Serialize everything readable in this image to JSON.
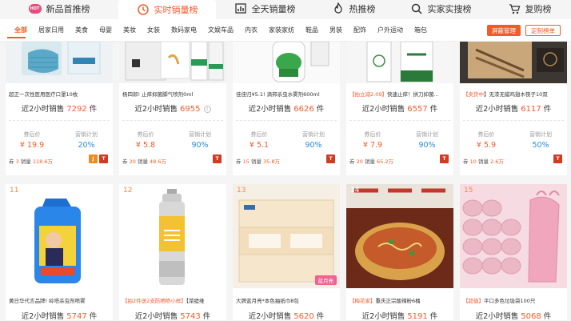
{
  "top_tabs": [
    {
      "label": "新品首推榜",
      "icon": "hot-badge",
      "icon_text": "HOT",
      "active": false
    },
    {
      "label": "实时销量榜",
      "icon": "clock-icon",
      "active": true
    },
    {
      "label": "全天销量榜",
      "icon": "bar-chart-icon",
      "active": false
    },
    {
      "label": "热推榜",
      "icon": "flame-icon",
      "active": false
    },
    {
      "label": "实家实搜榜",
      "icon": "search-icon",
      "active": false
    },
    {
      "label": "复购榜",
      "icon": "cart-icon",
      "active": false
    }
  ],
  "categories": [
    "全部",
    "居家日用",
    "美食",
    "母婴",
    "美妆",
    "女装",
    "数码家电",
    "文娱车品",
    "内衣",
    "家装家纺",
    "鞋品",
    "男装",
    "配饰",
    "户外运动",
    "箱包"
  ],
  "category_buttons": {
    "manage": "屏蔽管理",
    "custom": "定制榜单"
  },
  "labels": {
    "coupon_price": "券后价",
    "commission": "营销计划",
    "sales_prefix": "近2小时销售",
    "sales_suffix": "件",
    "coupon_prefix": "券",
    "sold_prefix": "销量"
  },
  "products_row1": [
    {
      "title": "超正一次性医用医疗口罩10枚",
      "sales": "7292",
      "price": "¥ 19.9",
      "commission": "20%",
      "coupon": "3",
      "sold": "118.6万",
      "badges": [
        "jd",
        "tm"
      ]
    },
    {
      "title": "杨四郎! 止痒抑菌脚气喷剂0ml",
      "sales": "6955",
      "price": "¥ 5.8",
      "commission": "90%",
      "coupon": "20",
      "sold": "48.6万",
      "badges": [
        "tm"
      ]
    },
    {
      "title": "佳佳归¥5.1! 滴邦杀虫水雾剂600ml",
      "sales": "6626",
      "price": "¥ 5.1",
      "commission": "90%",
      "coupon": "15",
      "sold": "35.8万",
      "badges": [
        "tm"
      ]
    },
    {
      "title_tag": "【拍立减2.09】",
      "title": "快速止痒！拼刀抑菌...",
      "sales": "6557",
      "price": "¥ 7.9",
      "commission": "90%",
      "coupon": "20",
      "sold": "65.2万",
      "badges": [
        "tm"
      ]
    },
    {
      "title_tag": "【卖货中",
      "title": "】无漆无蜡鸡翅木筷子10双",
      "sales": "6117",
      "price": "¥ 5.9",
      "commission": "50%",
      "coupon": "10",
      "sold": "2.6万",
      "badges": [
        "tm"
      ]
    }
  ],
  "products_row2": [
    {
      "rank": "11",
      "title": "黄日华代言品牌! 岭塔杀虫剂喷雾",
      "sales": "5747",
      "img": "spray-bottle"
    },
    {
      "rank": "12",
      "title_tag": "【拍2件送2支防晒喷小样】",
      "title": "【菜缇维",
      "sales": "5743",
      "img": "sunscreen-can"
    },
    {
      "rank": "13",
      "title": "大牌蓝月亮*本色抽纸巾8包",
      "sales": "5620",
      "img": "tissue-packs",
      "tag": "蓝月亮"
    },
    {
      "rank": "14",
      "title_tag": "【梅花家】",
      "title": "重庆正宗酸辣粉6桶",
      "sales": "5191",
      "img": "noodle-bowl"
    },
    {
      "rank": "15",
      "title_tag": "【超值】",
      "title": "平口多色垃圾袋100只",
      "sales": "5068",
      "img": "trash-bags"
    }
  ]
}
